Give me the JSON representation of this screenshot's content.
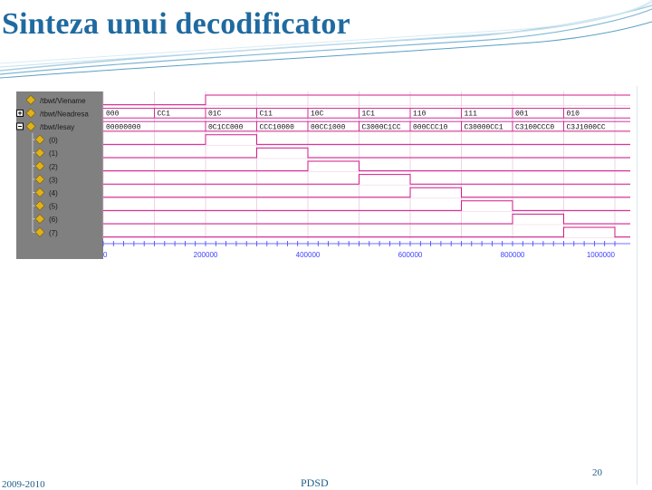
{
  "slide": {
    "title": "Sinteza unui decodificator",
    "footer_left": "2009-2010",
    "footer_center": "PDSD",
    "page_number": "20"
  },
  "colors": {
    "title": "#1f6aa0",
    "panel_gray": "#808080",
    "wave_bg": "#ffffff",
    "wave_line": "#d01a8a",
    "time_axis": "#3f3fff",
    "signal_icon": "#e0b21a"
  },
  "waveform_viewer": {
    "signals": [
      {
        "label": "/tbwt/Viename",
        "expander": "",
        "icon": "diamond-signal-icon"
      },
      {
        "label": "/tbwt/Neadresa",
        "expander": "+",
        "icon": "diamond-signal-icon"
      },
      {
        "label": "/tbwt/Iesay",
        "expander": "-",
        "icon": "diamond-signal-icon"
      },
      {
        "label": "(0)",
        "expander": "",
        "icon": "diamond-signal-icon"
      },
      {
        "label": "(1)",
        "expander": "",
        "icon": "diamond-signal-icon"
      },
      {
        "label": "(2)",
        "expander": "",
        "icon": "diamond-signal-icon"
      },
      {
        "label": "(3)",
        "expander": "",
        "icon": "diamond-signal-icon"
      },
      {
        "label": "(4)",
        "expander": "",
        "icon": "diamond-signal-icon"
      },
      {
        "label": "(5)",
        "expander": "",
        "icon": "diamond-signal-icon"
      },
      {
        "label": "(6)",
        "expander": "",
        "icon": "diamond-signal-icon"
      },
      {
        "label": "(7)",
        "expander": "",
        "icon": "diamond-signal-icon"
      }
    ],
    "address_values": [
      "000",
      "CC1",
      "01C",
      "C11",
      "10C",
      "1C1",
      "110",
      "111",
      "001",
      "010"
    ],
    "output_values": [
      "00000000",
      "",
      "0C1CC000",
      "CCC10000",
      "00CC1000",
      "C3000C1CC",
      "000CCC10",
      "C30000CC1",
      "C3100CCC0",
      "C3J1000CC"
    ],
    "enable_levels": [
      0,
      0,
      1,
      1,
      1,
      1,
      1,
      1,
      1,
      1
    ],
    "output_bit_high_segment": [
      -1,
      -1,
      1,
      2,
      3,
      4,
      5,
      6,
      7,
      8
    ],
    "time_ticks": [
      "0",
      "200000",
      "400000",
      "600000",
      "800000",
      "1000000"
    ]
  }
}
